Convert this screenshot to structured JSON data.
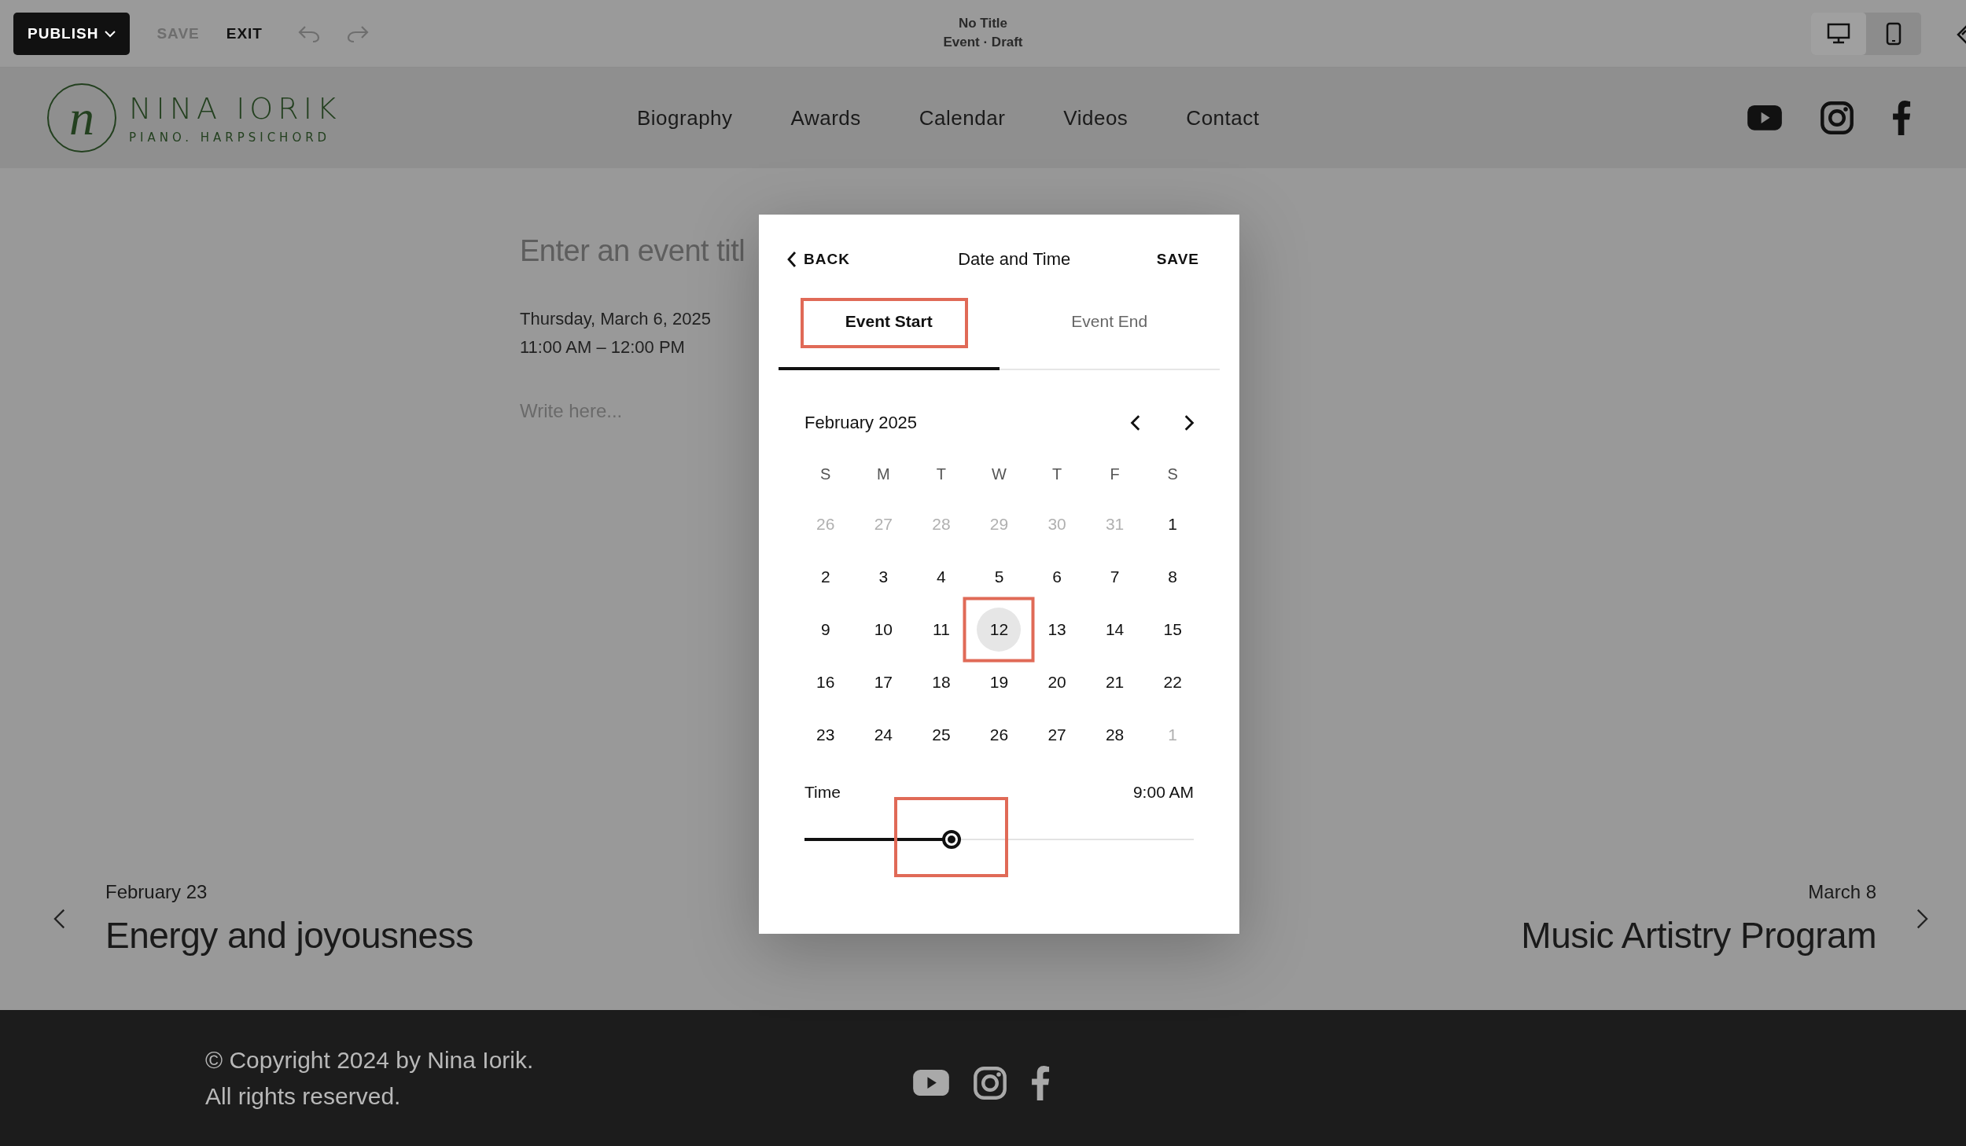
{
  "editor_bar": {
    "publish": "PUBLISH",
    "save": "SAVE",
    "exit": "EXIT",
    "page_title": "No Title",
    "page_status": "Event · Draft",
    "devices": [
      {
        "kind": "desktop",
        "selected": true
      },
      {
        "kind": "mobile",
        "selected": false
      }
    ]
  },
  "site_header": {
    "logo_letter": "n",
    "logo_name": "NINA IORIK",
    "logo_tagline": "PIANO. HARPSICHORD",
    "nav": [
      "Biography",
      "Awards",
      "Calendar",
      "Videos",
      "Contact"
    ]
  },
  "event": {
    "title_placeholder": "Enter an event titl",
    "date": "Thursday, March 6, 2025",
    "time": "11:00 AM – 12:00 PM",
    "body_placeholder": "Write here..."
  },
  "previous_event": {
    "date": "February 23",
    "title": "Energy and joyousness"
  },
  "next_event": {
    "date": "March 8",
    "title": "Music Artistry Program"
  },
  "footer": {
    "copyright": "© Copyright 2024 by Nina Iorik.",
    "rights": "All rights reserved."
  },
  "dialog": {
    "back": "BACK",
    "title": "Date and Time",
    "save": "SAVE",
    "tabs": [
      {
        "label": "Event Start",
        "selected": true,
        "annotated": true
      },
      {
        "label": "Event End",
        "selected": false,
        "annotated": false
      }
    ],
    "month": "February 2025",
    "weekdays": [
      "S",
      "M",
      "T",
      "W",
      "T",
      "F",
      "S"
    ],
    "days": [
      {
        "label": "26",
        "muted": true,
        "selected": false,
        "annotated": false
      },
      {
        "label": "27",
        "muted": true,
        "selected": false,
        "annotated": false
      },
      {
        "label": "28",
        "muted": true,
        "selected": false,
        "annotated": false
      },
      {
        "label": "29",
        "muted": true,
        "selected": false,
        "annotated": false
      },
      {
        "label": "30",
        "muted": true,
        "selected": false,
        "annotated": false
      },
      {
        "label": "31",
        "muted": true,
        "selected": false,
        "annotated": false
      },
      {
        "label": "1",
        "muted": false,
        "selected": false,
        "annotated": false
      },
      {
        "label": "2",
        "muted": false,
        "selected": false,
        "annotated": false
      },
      {
        "label": "3",
        "muted": false,
        "selected": false,
        "annotated": false
      },
      {
        "label": "4",
        "muted": false,
        "selected": false,
        "annotated": false
      },
      {
        "label": "5",
        "muted": false,
        "selected": false,
        "annotated": false
      },
      {
        "label": "6",
        "muted": false,
        "selected": false,
        "annotated": false
      },
      {
        "label": "7",
        "muted": false,
        "selected": false,
        "annotated": false
      },
      {
        "label": "8",
        "muted": false,
        "selected": false,
        "annotated": false
      },
      {
        "label": "9",
        "muted": false,
        "selected": false,
        "annotated": false
      },
      {
        "label": "10",
        "muted": false,
        "selected": false,
        "annotated": false
      },
      {
        "label": "11",
        "muted": false,
        "selected": false,
        "annotated": false
      },
      {
        "label": "12",
        "muted": false,
        "selected": true,
        "annotated": true
      },
      {
        "label": "13",
        "muted": false,
        "selected": false,
        "annotated": false
      },
      {
        "label": "14",
        "muted": false,
        "selected": false,
        "annotated": false
      },
      {
        "label": "15",
        "muted": false,
        "selected": false,
        "annotated": false
      },
      {
        "label": "16",
        "muted": false,
        "selected": false,
        "annotated": false
      },
      {
        "label": "17",
        "muted": false,
        "selected": false,
        "annotated": false
      },
      {
        "label": "18",
        "muted": false,
        "selected": false,
        "annotated": false
      },
      {
        "label": "19",
        "muted": false,
        "selected": false,
        "annotated": false
      },
      {
        "label": "20",
        "muted": false,
        "selected": false,
        "annotated": false
      },
      {
        "label": "21",
        "muted": false,
        "selected": false,
        "annotated": false
      },
      {
        "label": "22",
        "muted": false,
        "selected": false,
        "annotated": false
      },
      {
        "label": "23",
        "muted": false,
        "selected": false,
        "annotated": false
      },
      {
        "label": "24",
        "muted": false,
        "selected": false,
        "annotated": false
      },
      {
        "label": "25",
        "muted": false,
        "selected": false,
        "annotated": false
      },
      {
        "label": "26",
        "muted": false,
        "selected": false,
        "annotated": false
      },
      {
        "label": "27",
        "muted": false,
        "selected": false,
        "annotated": false
      },
      {
        "label": "28",
        "muted": false,
        "selected": false,
        "annotated": false
      },
      {
        "label": "1",
        "muted": true,
        "selected": false,
        "annotated": false
      }
    ],
    "time": {
      "label": "Time",
      "value": "9:00 AM",
      "level": 0.377,
      "annotated": true
    }
  }
}
